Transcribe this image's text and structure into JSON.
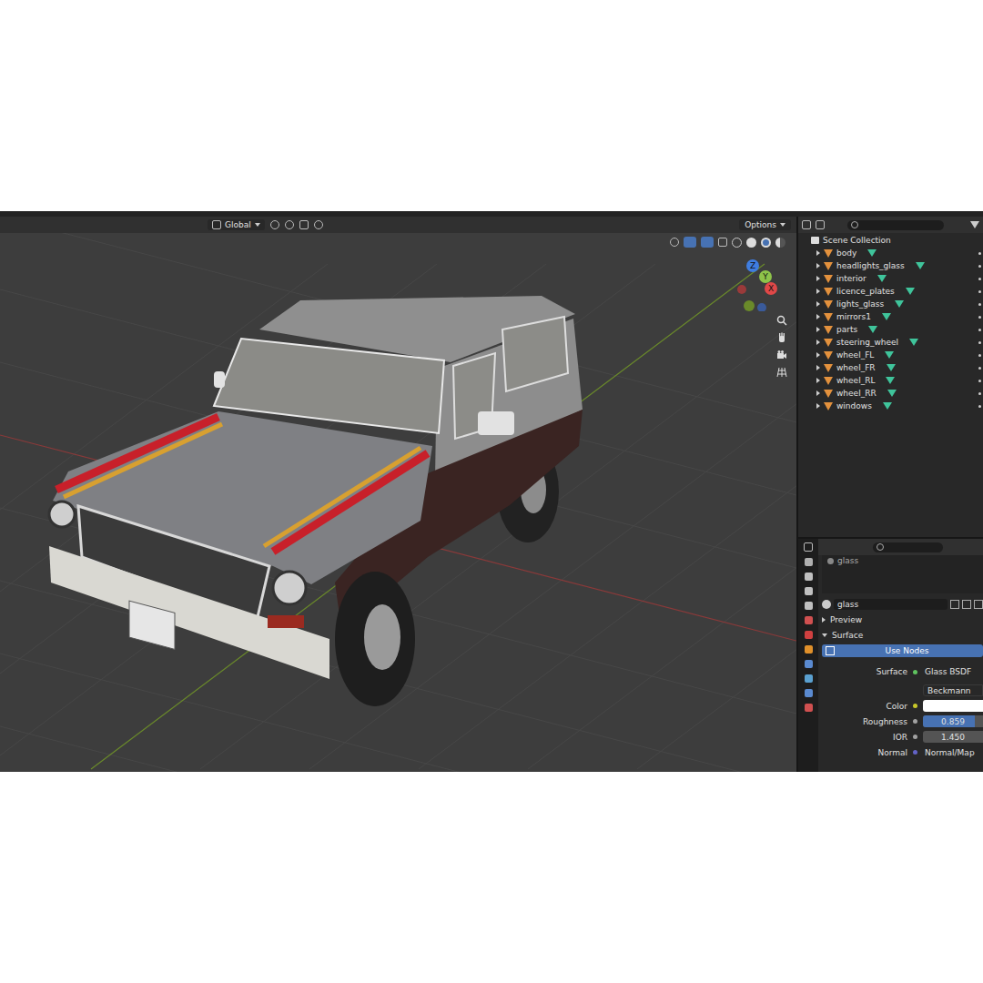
{
  "viewport_header": {
    "orientation": "Global",
    "options": "Options"
  },
  "gizmo": {
    "x": "X",
    "y": "Y",
    "z": "Z"
  },
  "outliner": {
    "root": "Scene Collection",
    "search": {
      "placeholder": ""
    },
    "items": [
      {
        "name": "body",
        "expanded": false
      },
      {
        "name": "headlights_glass",
        "expanded": false
      },
      {
        "name": "interior",
        "expanded": false
      },
      {
        "name": "licence_plates",
        "expanded": false
      },
      {
        "name": "lights_glass",
        "expanded": false
      },
      {
        "name": "mirrors1",
        "expanded": false
      },
      {
        "name": "parts",
        "expanded": false
      },
      {
        "name": "steering_wheel",
        "expanded": false
      },
      {
        "name": "wheel_FL",
        "expanded": false
      },
      {
        "name": "wheel_FR",
        "expanded": false
      },
      {
        "name": "wheel_RL",
        "expanded": false
      },
      {
        "name": "wheel_RR",
        "expanded": false
      },
      {
        "name": "windows",
        "expanded": false
      }
    ]
  },
  "properties": {
    "slot": "glass",
    "material": "glass",
    "panels": [
      {
        "label": "Preview",
        "expanded": false
      },
      {
        "label": "Surface",
        "expanded": true
      }
    ],
    "use_nodes": "Use Nodes",
    "fields": [
      {
        "label": "Surface",
        "value": "Glass BSDF",
        "kind": "shader"
      },
      {
        "label": "",
        "value": "Beckmann",
        "kind": "dropdown"
      },
      {
        "label": "Color",
        "value": "",
        "kind": "color",
        "color": "#ffffff"
      },
      {
        "label": "Roughness",
        "value": "0.859",
        "kind": "slider",
        "level": 0.859
      },
      {
        "label": "IOR",
        "value": "1.450",
        "kind": "number"
      },
      {
        "label": "Normal",
        "value": "Normal/Map",
        "kind": "link"
      }
    ]
  }
}
